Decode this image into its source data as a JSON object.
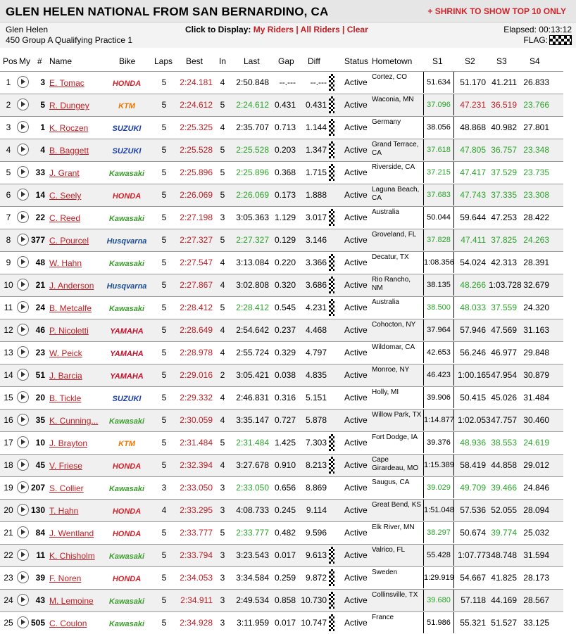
{
  "header": {
    "title": "GLEN HELEN NATIONAL FROM SAN BERNARDINO, CA",
    "shrink_link": "+ SHRINK TO SHOW TOP 10 ONLY",
    "venue": "Glen Helen",
    "session": "450 Group A Qualifying Practice 1",
    "display_prompt": "Click to Display:",
    "display_links": [
      "My Riders",
      "All Riders",
      "Clear"
    ],
    "elapsed_label": "Elapsed:",
    "elapsed_value": "00:13:12",
    "flag_label": "FLAG:",
    "flag_icon": "checkered-flag-icon"
  },
  "columns": {
    "pos": "Pos",
    "my": "My",
    "num": "#",
    "name": "Name",
    "bike": "Bike",
    "laps": "Laps",
    "best": "Best",
    "in": "In",
    "last": "Last",
    "gap": "Gap",
    "diff": "Diff",
    "status": "Status",
    "hometown": "Hometown",
    "s1": "S1",
    "s2": "S2",
    "s3": "S3",
    "s4": "S4"
  },
  "colors": {
    "accent_red": "#c41e24",
    "best_green": "#2aa52a",
    "honda": "#d2232a",
    "ktm": "#f07800",
    "suzuki": "#1b3ea5",
    "kawasaki": "#3d9d2e",
    "husqvarna": "#1d4b8f",
    "yamaha": "#c8102e"
  },
  "riders": [
    {
      "pos": "1",
      "num": "3",
      "name": "E. Tomac",
      "bike": "HONDA",
      "laps": "5",
      "best": "2:24.181",
      "in": "4",
      "last": "2:50.848",
      "last_best": false,
      "gap": "--.---",
      "diff": "--.---",
      "flag": true,
      "status": "Active",
      "hometown": "Cortez, CO",
      "s1": "51.634",
      "s2": "51.170",
      "s3": "41.211",
      "s4": "26.833",
      "s1c": "",
      "s2c": "",
      "s3c": "",
      "s4c": ""
    },
    {
      "pos": "2",
      "num": "5",
      "name": "R. Dungey",
      "bike": "KTM",
      "laps": "5",
      "best": "2:24.612",
      "in": "5",
      "last": "2:24.612",
      "last_best": true,
      "gap": "0.431",
      "diff": "0.431",
      "flag": true,
      "status": "Active",
      "hometown": "Waconia, MN",
      "s1": "37.096",
      "s2": "47.231",
      "s3": "36.519",
      "s4": "23.766",
      "s1c": "green",
      "s2c": "red",
      "s3c": "red",
      "s4c": "green"
    },
    {
      "pos": "3",
      "num": "1",
      "name": "K. Roczen",
      "bike": "SUZUKI",
      "laps": "5",
      "best": "2:25.325",
      "in": "4",
      "last": "2:35.707",
      "last_best": false,
      "gap": "0.713",
      "diff": "1.144",
      "flag": true,
      "status": "Active",
      "hometown": "Germany",
      "s1": "38.056",
      "s2": "48.868",
      "s3": "40.982",
      "s4": "27.801",
      "s1c": "",
      "s2c": "",
      "s3c": "",
      "s4c": ""
    },
    {
      "pos": "4",
      "num": "4",
      "name": "B. Baggett",
      "bike": "SUZUKI",
      "laps": "5",
      "best": "2:25.528",
      "in": "5",
      "last": "2:25.528",
      "last_best": true,
      "gap": "0.203",
      "diff": "1.347",
      "flag": true,
      "status": "Active",
      "hometown": "Grand Terrace, CA",
      "s1": "37.618",
      "s2": "47.805",
      "s3": "36.757",
      "s4": "23.348",
      "s1c": "green",
      "s2c": "green",
      "s3c": "green",
      "s4c": "green"
    },
    {
      "pos": "5",
      "num": "33",
      "name": "J. Grant",
      "bike": "Kawasaki",
      "laps": "5",
      "best": "2:25.896",
      "in": "5",
      "last": "2:25.896",
      "last_best": true,
      "gap": "0.368",
      "diff": "1.715",
      "flag": true,
      "status": "Active",
      "hometown": "Riverside, CA",
      "s1": "37.215",
      "s2": "47.417",
      "s3": "37.529",
      "s4": "23.735",
      "s1c": "green",
      "s2c": "green",
      "s3c": "green",
      "s4c": "green"
    },
    {
      "pos": "6",
      "num": "14",
      "name": "C. Seely",
      "bike": "HONDA",
      "laps": "5",
      "best": "2:26.069",
      "in": "5",
      "last": "2:26.069",
      "last_best": true,
      "gap": "0.173",
      "diff": "1.888",
      "flag": false,
      "status": "Active",
      "hometown": "Laguna Beach, CA",
      "s1": "37.683",
      "s2": "47.743",
      "s3": "37.335",
      "s4": "23.308",
      "s1c": "green",
      "s2c": "green",
      "s3c": "green",
      "s4c": "green"
    },
    {
      "pos": "7",
      "num": "22",
      "name": "C. Reed",
      "bike": "Kawasaki",
      "laps": "5",
      "best": "2:27.198",
      "in": "3",
      "last": "3:05.363",
      "last_best": false,
      "gap": "1.129",
      "diff": "3.017",
      "flag": true,
      "status": "Active",
      "hometown": "Australia",
      "s1": "50.044",
      "s2": "59.644",
      "s3": "47.253",
      "s4": "28.422",
      "s1c": "",
      "s2c": "",
      "s3c": "",
      "s4c": ""
    },
    {
      "pos": "8",
      "num": "377",
      "name": "C. Pourcel",
      "bike": "Husqvarna",
      "laps": "5",
      "best": "2:27.327",
      "in": "5",
      "last": "2:27.327",
      "last_best": true,
      "gap": "0.129",
      "diff": "3.146",
      "flag": false,
      "status": "Active",
      "hometown": "Groveland, FL",
      "s1": "37.828",
      "s2": "47.411",
      "s3": "37.825",
      "s4": "24.263",
      "s1c": "green",
      "s2c": "green",
      "s3c": "green",
      "s4c": "green"
    },
    {
      "pos": "9",
      "num": "48",
      "name": "W. Hahn",
      "bike": "Kawasaki",
      "laps": "5",
      "best": "2:27.547",
      "in": "4",
      "last": "3:13.084",
      "last_best": false,
      "gap": "0.220",
      "diff": "3.366",
      "flag": true,
      "status": "Active",
      "hometown": "Decatur, TX",
      "s1": "1:08.356",
      "s2": "54.024",
      "s3": "42.313",
      "s4": "28.391",
      "s1c": "",
      "s2c": "",
      "s3c": "",
      "s4c": ""
    },
    {
      "pos": "10",
      "num": "21",
      "name": "J. Anderson",
      "bike": "Husqvarna",
      "laps": "5",
      "best": "2:27.867",
      "in": "4",
      "last": "3:02.808",
      "last_best": false,
      "gap": "0.320",
      "diff": "3.686",
      "flag": true,
      "status": "Active",
      "hometown": "Rio Rancho, NM",
      "s1": "38.135",
      "s2": "48.266",
      "s3": "1:03.728",
      "s4": "32.679",
      "s1c": "",
      "s2c": "green",
      "s3c": "",
      "s4c": ""
    },
    {
      "pos": "11",
      "num": "24",
      "name": "B. Metcalfe",
      "bike": "Kawasaki",
      "laps": "5",
      "best": "2:28.412",
      "in": "5",
      "last": "2:28.412",
      "last_best": true,
      "gap": "0.545",
      "diff": "4.231",
      "flag": true,
      "status": "Active",
      "hometown": "Australia",
      "s1": "38.500",
      "s2": "48.033",
      "s3": "37.559",
      "s4": "24.320",
      "s1c": "green",
      "s2c": "green",
      "s3c": "green",
      "s4c": ""
    },
    {
      "pos": "12",
      "num": "46",
      "name": "P. Nicoletti",
      "bike": "YAMAHA",
      "laps": "5",
      "best": "2:28.649",
      "in": "4",
      "last": "2:54.642",
      "last_best": false,
      "gap": "0.237",
      "diff": "4.468",
      "flag": false,
      "status": "Active",
      "hometown": "Cohocton, NY",
      "s1": "37.964",
      "s2": "57.946",
      "s3": "47.569",
      "s4": "31.163",
      "s1c": "",
      "s2c": "",
      "s3c": "",
      "s4c": ""
    },
    {
      "pos": "13",
      "num": "23",
      "name": "W. Peick",
      "bike": "YAMAHA",
      "laps": "5",
      "best": "2:28.978",
      "in": "4",
      "last": "2:55.724",
      "last_best": false,
      "gap": "0.329",
      "diff": "4.797",
      "flag": false,
      "status": "Active",
      "hometown": "Wildomar, CA",
      "s1": "42.653",
      "s2": "56.246",
      "s3": "46.977",
      "s4": "29.848",
      "s1c": "",
      "s2c": "",
      "s3c": "",
      "s4c": ""
    },
    {
      "pos": "14",
      "num": "51",
      "name": "J. Barcia",
      "bike": "YAMAHA",
      "laps": "5",
      "best": "2:29.016",
      "in": "2",
      "last": "3:05.421",
      "last_best": false,
      "gap": "0.038",
      "diff": "4.835",
      "flag": false,
      "status": "Active",
      "hometown": "Monroe, NY",
      "s1": "46.423",
      "s2": "1:00.165",
      "s3": "47.954",
      "s4": "30.879",
      "s1c": "",
      "s2c": "",
      "s3c": "",
      "s4c": ""
    },
    {
      "pos": "15",
      "num": "20",
      "name": "B. Tickle",
      "bike": "SUZUKI",
      "laps": "5",
      "best": "2:29.332",
      "in": "4",
      "last": "2:46.831",
      "last_best": false,
      "gap": "0.316",
      "diff": "5.151",
      "flag": false,
      "status": "Active",
      "hometown": "Holly, MI",
      "s1": "39.906",
      "s2": "50.415",
      "s3": "45.026",
      "s4": "31.484",
      "s1c": "",
      "s2c": "",
      "s3c": "",
      "s4c": ""
    },
    {
      "pos": "16",
      "num": "35",
      "name": "K. Cunning...",
      "bike": "Kawasaki",
      "laps": "5",
      "best": "2:30.059",
      "in": "4",
      "last": "3:35.147",
      "last_best": false,
      "gap": "0.727",
      "diff": "5.878",
      "flag": false,
      "status": "Active",
      "hometown": "Willow Park, TX",
      "s1": "1:14.877",
      "s2": "1:02.053",
      "s3": "47.757",
      "s4": "30.460",
      "s1c": "",
      "s2c": "",
      "s3c": "",
      "s4c": ""
    },
    {
      "pos": "17",
      "num": "10",
      "name": "J. Brayton",
      "bike": "KTM",
      "laps": "5",
      "best": "2:31.484",
      "in": "5",
      "last": "2:31.484",
      "last_best": true,
      "gap": "1.425",
      "diff": "7.303",
      "flag": true,
      "status": "Active",
      "hometown": "Fort Dodge, IA",
      "s1": "39.376",
      "s2": "48.936",
      "s3": "38.553",
      "s4": "24.619",
      "s1c": "",
      "s2c": "green",
      "s3c": "green",
      "s4c": "green"
    },
    {
      "pos": "18",
      "num": "45",
      "name": "V. Friese",
      "bike": "HONDA",
      "laps": "5",
      "best": "2:32.394",
      "in": "4",
      "last": "3:27.678",
      "last_best": false,
      "gap": "0.910",
      "diff": "8.213",
      "flag": true,
      "status": "Active",
      "hometown": "Cape Girardeau, MO",
      "s1": "1:15.389",
      "s2": "58.419",
      "s3": "44.858",
      "s4": "29.012",
      "s1c": "",
      "s2c": "",
      "s3c": "",
      "s4c": ""
    },
    {
      "pos": "19",
      "num": "207",
      "name": "S. Collier",
      "bike": "Kawasaki",
      "laps": "3",
      "best": "2:33.050",
      "in": "3",
      "last": "2:33.050",
      "last_best": true,
      "gap": "0.656",
      "diff": "8.869",
      "flag": false,
      "status": "Active",
      "hometown": "Saugus, CA",
      "s1": "39.029",
      "s2": "49.709",
      "s3": "39.466",
      "s4": "24.846",
      "s1c": "green",
      "s2c": "green",
      "s3c": "green",
      "s4c": ""
    },
    {
      "pos": "20",
      "num": "130",
      "name": "T. Hahn",
      "bike": "HONDA",
      "laps": "4",
      "best": "2:33.295",
      "in": "3",
      "last": "4:08.733",
      "last_best": false,
      "gap": "0.245",
      "diff": "9.114",
      "flag": false,
      "status": "Active",
      "hometown": "Great Bend, KS",
      "s1": "1:51.048",
      "s2": "57.536",
      "s3": "52.055",
      "s4": "28.094",
      "s1c": "",
      "s2c": "",
      "s3c": "",
      "s4c": ""
    },
    {
      "pos": "21",
      "num": "84",
      "name": "J. Wentland",
      "bike": "HONDA",
      "laps": "5",
      "best": "2:33.777",
      "in": "5",
      "last": "2:33.777",
      "last_best": true,
      "gap": "0.482",
      "diff": "9.596",
      "flag": false,
      "status": "Active",
      "hometown": "Elk River, MN",
      "s1": "38.297",
      "s2": "50.674",
      "s3": "39.774",
      "s4": "25.032",
      "s1c": "green",
      "s2c": "",
      "s3c": "green",
      "s4c": ""
    },
    {
      "pos": "22",
      "num": "11",
      "name": "K. Chisholm",
      "bike": "Kawasaki",
      "laps": "5",
      "best": "2:33.794",
      "in": "3",
      "last": "3:23.543",
      "last_best": false,
      "gap": "0.017",
      "diff": "9.613",
      "flag": true,
      "status": "Active",
      "hometown": "Valrico, FL",
      "s1": "55.428",
      "s2": "1:07.773",
      "s3": "48.748",
      "s4": "31.594",
      "s1c": "",
      "s2c": "",
      "s3c": "",
      "s4c": ""
    },
    {
      "pos": "23",
      "num": "39",
      "name": "F. Noren",
      "bike": "HONDA",
      "laps": "5",
      "best": "2:34.053",
      "in": "3",
      "last": "3:34.584",
      "last_best": false,
      "gap": "0.259",
      "diff": "9.872",
      "flag": true,
      "status": "Active",
      "hometown": "Sweden",
      "s1": "1:29.919",
      "s2": "54.667",
      "s3": "41.825",
      "s4": "28.173",
      "s1c": "",
      "s2c": "",
      "s3c": "",
      "s4c": ""
    },
    {
      "pos": "24",
      "num": "43",
      "name": "M. Lemoine",
      "bike": "Kawasaki",
      "laps": "5",
      "best": "2:34.911",
      "in": "3",
      "last": "2:49.534",
      "last_best": false,
      "gap": "0.858",
      "diff": "10.730",
      "flag": true,
      "status": "Active",
      "hometown": "Collinsville, TX",
      "s1": "39.680",
      "s2": "57.118",
      "s3": "44.169",
      "s4": "28.567",
      "s1c": "green",
      "s2c": "",
      "s3c": "",
      "s4c": ""
    },
    {
      "pos": "25",
      "num": "505",
      "name": "C. Coulon",
      "bike": "Kawasaki",
      "laps": "5",
      "best": "2:34.928",
      "in": "3",
      "last": "3:11.959",
      "last_best": false,
      "gap": "0.017",
      "diff": "10.747",
      "flag": true,
      "status": "Active",
      "hometown": "France",
      "s1": "51.986",
      "s2": "55.321",
      "s3": "51.527",
      "s4": "33.125",
      "s1c": "",
      "s2c": "",
      "s3c": "",
      "s4c": ""
    }
  ]
}
